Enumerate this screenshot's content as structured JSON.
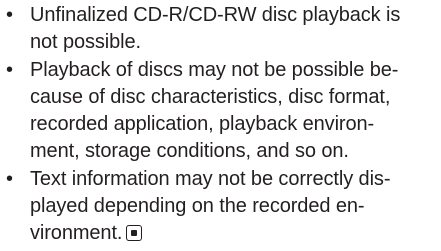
{
  "bullet_symbol": "•",
  "items": [
    {
      "lines": [
        "Unfinalized CD-R/CD-RW disc playback is",
        "not possible."
      ]
    },
    {
      "lines": [
        "Playback of discs may not be possible be-",
        "cause of disc characteristics, disc format,",
        "recorded application, playback environ-",
        "ment, storage conditions, and so on."
      ]
    },
    {
      "lines": [
        "Text information may not be correctly dis-",
        "played depending on the recorded en-",
        "vironment."
      ]
    }
  ],
  "end_mark_icon": "end-of-section-mark-icon"
}
